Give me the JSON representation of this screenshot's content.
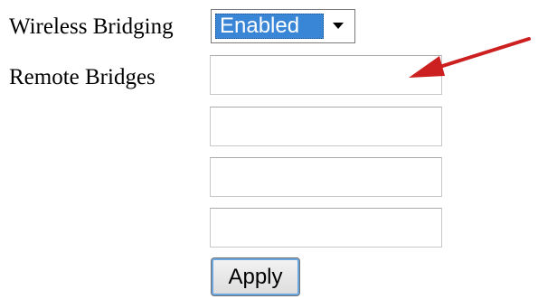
{
  "form": {
    "wireless_bridging_label": "Wireless Bridging",
    "wireless_bridging_value": "Enabled",
    "remote_bridges_label": "Remote Bridges",
    "remote_bridges": [
      {
        "value": ""
      },
      {
        "value": ""
      },
      {
        "value": ""
      },
      {
        "value": ""
      }
    ],
    "apply_label": "Apply"
  },
  "icons": {
    "dropdown": "chevron-down-icon",
    "annotation": "red-arrow-icon"
  },
  "colors": {
    "selection_highlight": "#3a86d6",
    "annotation_arrow": "#cc1f1f"
  }
}
